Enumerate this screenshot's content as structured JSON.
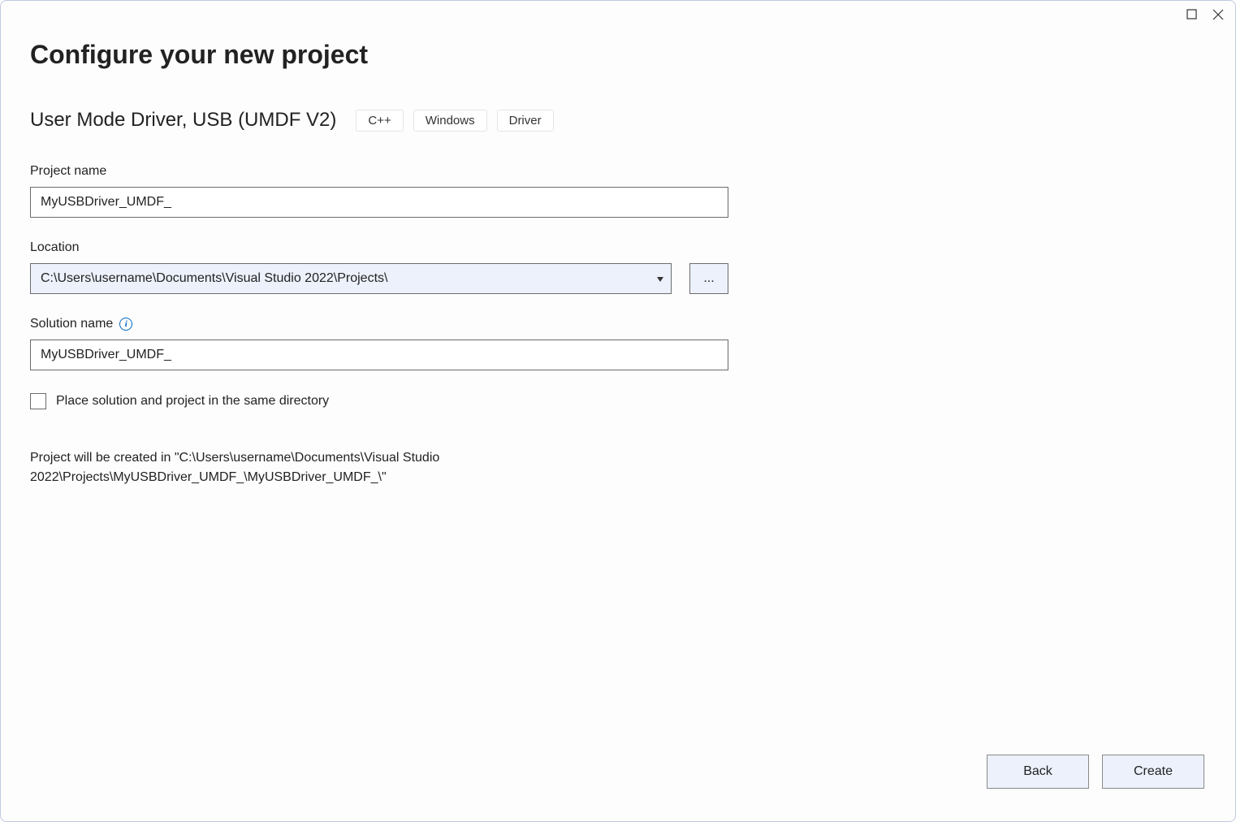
{
  "header": {
    "title": "Configure your new project"
  },
  "template": {
    "name": "User Mode Driver, USB (UMDF V2)",
    "tags": [
      "C++",
      "Windows",
      "Driver"
    ]
  },
  "fields": {
    "project_name": {
      "label": "Project name",
      "value": "MyUSBDriver_UMDF_"
    },
    "location": {
      "label": "Location",
      "value": "C:\\Users\\username\\Documents\\Visual Studio 2022\\Projects\\",
      "browse_label": "..."
    },
    "solution_name": {
      "label": "Solution name",
      "value": "MyUSBDriver_UMDF_"
    },
    "same_directory": {
      "label": "Place solution and project in the same directory",
      "checked": false
    }
  },
  "path_preview": "Project will be created in \"C:\\Users\\username\\Documents\\Visual Studio 2022\\Projects\\MyUSBDriver_UMDF_\\MyUSBDriver_UMDF_\\\"",
  "footer": {
    "back_label": "Back",
    "create_label": "Create"
  }
}
